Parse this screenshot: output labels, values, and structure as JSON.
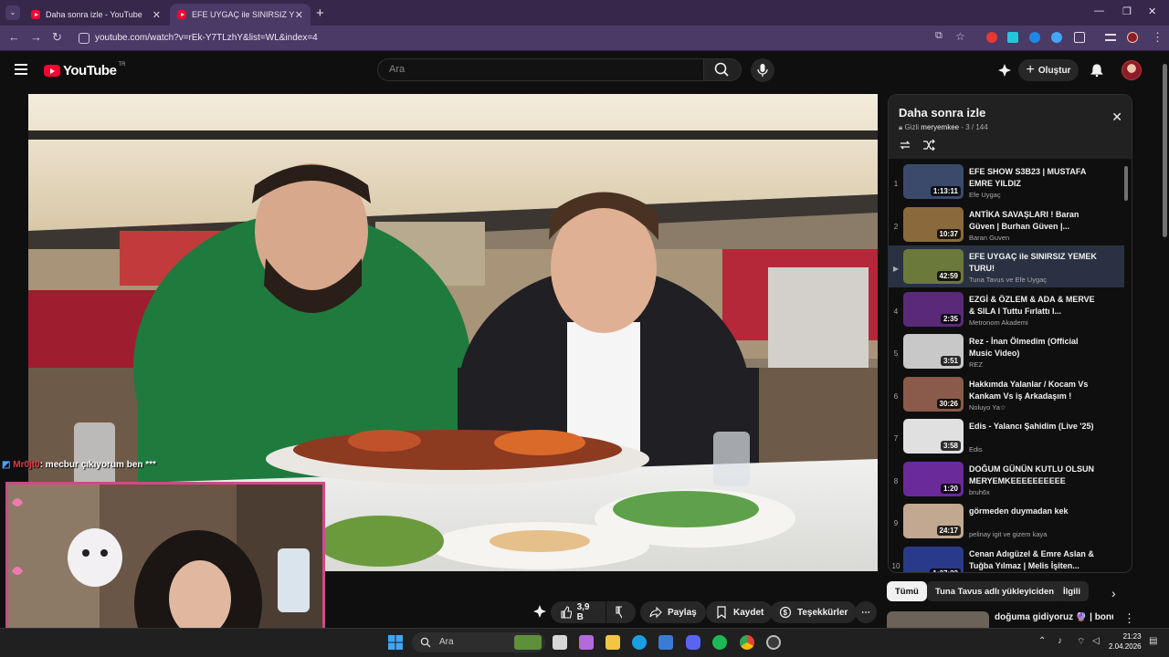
{
  "browser": {
    "tabs": [
      {
        "title": "Daha sonra izle - YouTube"
      },
      {
        "title": "EFE UYGAÇ ile SINIRSIZ YEMEK"
      }
    ],
    "url": "youtube.com/watch?v=rEk-Y7TLzhY&list=WL&index=4"
  },
  "header": {
    "logo_text": "YouTube",
    "country_code": "TR",
    "search_placeholder": "Ara",
    "create_label": "Oluştur"
  },
  "actions": {
    "like_count": "3,9 B",
    "share_label": "Paylaş",
    "save_label": "Kaydet",
    "thanks_label": "Teşekkürler"
  },
  "playlist": {
    "title": "Daha sonra izle",
    "privacy": "Gizli",
    "owner": "meryemkee",
    "position": "3 / 144",
    "items": [
      {
        "index": "1",
        "title": "EFE SHOW S3B23 | MUSTAFA EMRE YILDIZ",
        "channel": "Efe Uygaç",
        "duration": "1:13:11"
      },
      {
        "index": "2",
        "title": "ANTİKA SAVAŞLARI ! Baran Güven | Burhan Güven |...",
        "channel": "Baran Guven",
        "duration": "10:37"
      },
      {
        "index": "▶",
        "title": "EFE UYGAÇ ile SINIRSIZ YEMEK TURU!",
        "channel": "Tuna Tavus ve Efe Uygaç",
        "duration": "42:59"
      },
      {
        "index": "4",
        "title": "EZGİ & ÖZLEM & ADA & MERVE & SILA I Tuttu Fırlattı I...",
        "channel": "Metronom Akademi",
        "duration": "2:35"
      },
      {
        "index": "5",
        "title": "Rez - İnan Ölmedim (Official Music Video)",
        "channel": "REZ",
        "duration": "3:51"
      },
      {
        "index": "6",
        "title": "Hakkımda Yalanlar / Kocam Vs Kankam Vs iş Arkadaşım !",
        "channel": "Noluyo Ya☆",
        "duration": "30:26"
      },
      {
        "index": "7",
        "title": "Edis - Yalancı Şahidim (Live '25)",
        "channel": "Edis",
        "duration": "3:58"
      },
      {
        "index": "8",
        "title": "DOĞUM GÜNÜN KUTLU OLSUN MERYEMKEEEEEEEEEE",
        "channel": "bruh6x",
        "duration": "1:20"
      },
      {
        "index": "9",
        "title": "görmeden duymadan kek",
        "channel": "pelinay igit ve gizem kaya",
        "duration": "24:17"
      },
      {
        "index": "10",
        "title": "Cenan Adıgüzel & Emre Aslan & Tuğba Yılmaz | Melis İşiten...",
        "channel": "",
        "duration": "1:37:23"
      }
    ]
  },
  "chips": [
    "Tümü",
    "Tuna Tavus adlı yükleyiciden",
    "İlgili"
  ],
  "recommend": {
    "title": "doğuma gidiyoruz 🔮 | bonus"
  },
  "overlay": {
    "chat_user": "Mr0jt0",
    "chat_text": ": mecbur çıkıyorum ben ***"
  },
  "taskbar": {
    "search_placeholder": "Ara",
    "time": "21:23",
    "date": "2.04.2026"
  }
}
